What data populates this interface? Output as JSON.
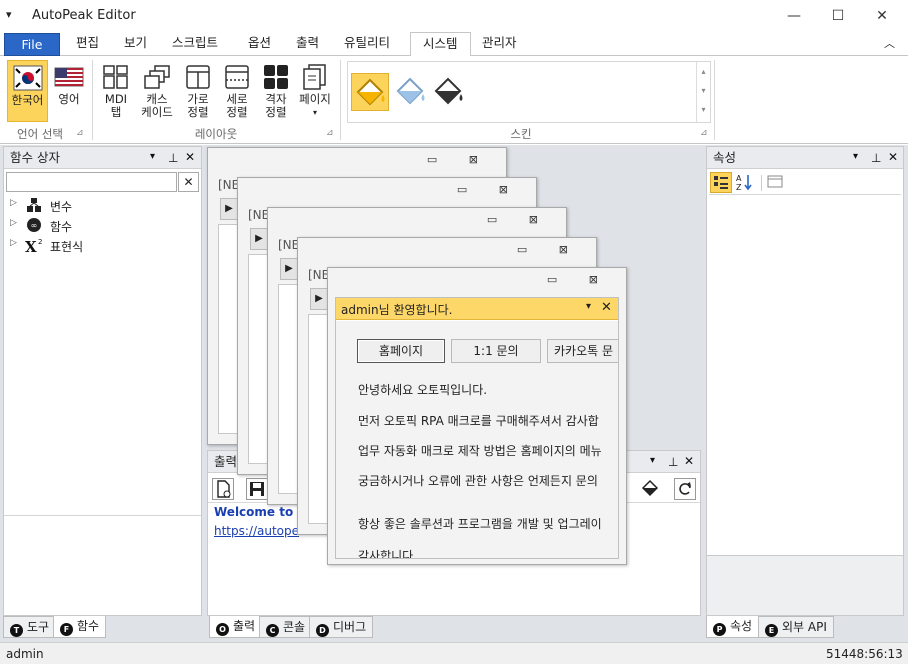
{
  "window": {
    "title": "AutoPeak Editor",
    "sysmenu": "▾",
    "min": "—",
    "max": "☐",
    "close": "✕"
  },
  "menu": {
    "file": "File",
    "tabs": [
      "편집",
      "보기",
      "스크립트",
      "옵션",
      "출력",
      "유틸리티",
      "시스템",
      "관리자"
    ],
    "collapse": "︿"
  },
  "ribbon": {
    "lang_korean": "한국어",
    "lang_english": "영어",
    "group_language": "언어 선택",
    "mdi_tab": [
      "MDI",
      "탭"
    ],
    "cascade": [
      "캐스",
      "케이드"
    ],
    "tile_h": [
      "가로",
      "정렬"
    ],
    "tile_v": [
      "세로",
      "정렬"
    ],
    "grid": [
      "격자",
      "정렬"
    ],
    "page": [
      "페이지",
      "▾"
    ],
    "group_layout": "레이아웃",
    "group_skin": "스킨",
    "launcher": "⊿"
  },
  "left_panel": {
    "title": "함수 상자",
    "search_placeholder": "",
    "clear": "✕",
    "tree": [
      {
        "expander": "▷",
        "label": "변수"
      },
      {
        "expander": "▷",
        "label": "함수"
      },
      {
        "expander": "▷",
        "label": "표현식"
      }
    ],
    "tabs": [
      {
        "badge": "T",
        "label": "도구"
      },
      {
        "badge": "F",
        "label": "함수"
      }
    ]
  },
  "right_panel": {
    "title": "속성",
    "tabs": [
      {
        "badge": "P",
        "label": "속성"
      },
      {
        "badge": "E",
        "label": "외부 API"
      }
    ]
  },
  "panel_controls": {
    "dropdown": "▾",
    "pin": "⊥",
    "close": "✕"
  },
  "children": {
    "nb_label": "[NE",
    "buttons": "▭ ⊠",
    "play": "▶"
  },
  "output_panel": {
    "title": "출력",
    "welcome": "Welcome to Au",
    "link": "https://autope",
    "tabs": [
      {
        "badge": "O",
        "label": "출력"
      },
      {
        "badge": "C",
        "label": "콘솔"
      },
      {
        "badge": "D",
        "label": "디버그"
      }
    ]
  },
  "welcome_dialog": {
    "header": "admin님 환영합니다.",
    "dropdown": "▾",
    "close": "✕",
    "buttons": [
      "홈페이지",
      "1:1 문의",
      "카카오톡 문"
    ],
    "lines": [
      "안녕하세요 오토픽입니다.",
      "먼저 오토픽 RPA 매크로를 구매해주셔서 감사합",
      "업무 자동화 매크로 제작 방법은 홈페이지의 메뉴",
      "궁금하시거나 오류에 관한 사항은 언제든지 문의",
      "",
      "항상 좋은 솔루션과 프로그램을 개발 및 업그레이",
      "감사합니다"
    ]
  },
  "statusbar": {
    "user": "admin",
    "coords": "51448:56:13"
  },
  "colors": {
    "accent": "#2b67c6",
    "selected": "#fcd35b",
    "dialog_header": "#fdd868"
  }
}
